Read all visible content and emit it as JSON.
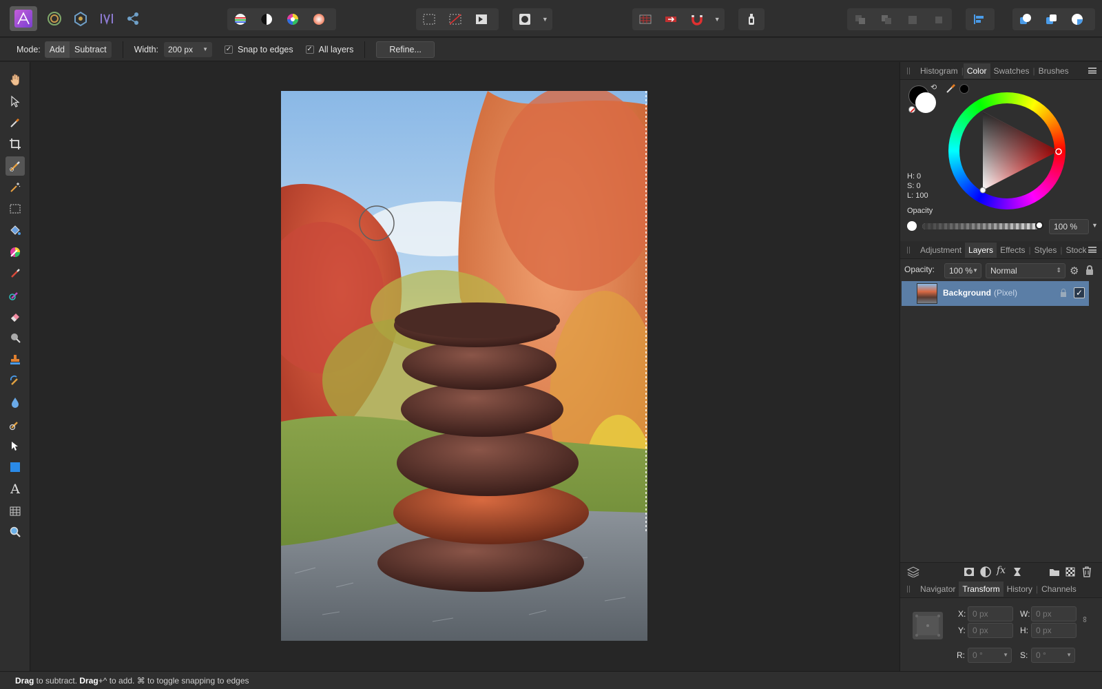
{
  "context_bar": {
    "mode_label": "Mode:",
    "mode_add": "Add",
    "mode_subtract": "Subtract",
    "width_label": "Width:",
    "width_value": "200 px",
    "snap_label": "Snap to edges",
    "snap_checked": true,
    "all_layers_label": "All layers",
    "all_layers_checked": true,
    "refine_label": "Refine..."
  },
  "color_panel": {
    "tabs": [
      "Histogram",
      "Color",
      "Swatches",
      "Brushes"
    ],
    "active_tab": "Color",
    "h": "H: 0",
    "s": "S: 0",
    "l": "L: 100",
    "opacity_label": "Opacity",
    "opacity_value": "100 %",
    "accent_color": "#e02020"
  },
  "layers_panel": {
    "tabs": [
      "Adjustment",
      "Layers",
      "Effects",
      "Styles",
      "Stock"
    ],
    "active_tab": "Layers",
    "opacity_label": "Opacity:",
    "opacity_value": "100 %",
    "blend_mode": "Normal",
    "layers": [
      {
        "name": "Background",
        "type": "(Pixel)",
        "visible": true,
        "locked": true,
        "selected": true
      }
    ]
  },
  "transform_panel": {
    "tabs": [
      "Navigator",
      "Transform",
      "History",
      "Channels"
    ],
    "active_tab": "Transform",
    "x_label": "X:",
    "x_value": "0 px",
    "y_label": "Y:",
    "y_value": "0 px",
    "w_label": "W:",
    "w_value": "0 px",
    "h_label": "H:",
    "h_value": "0 px",
    "r_label": "R:",
    "r_value": "0 °",
    "s_label": "S:",
    "s_value": "0 °"
  },
  "status_bar": {
    "drag1": "Drag",
    "text1": " to subtract. ",
    "drag2": "Drag",
    "text2": "+^ to add. ⌘ to toggle snapping to edges"
  },
  "photo": {
    "description_icon": "image-stacked-stones"
  }
}
